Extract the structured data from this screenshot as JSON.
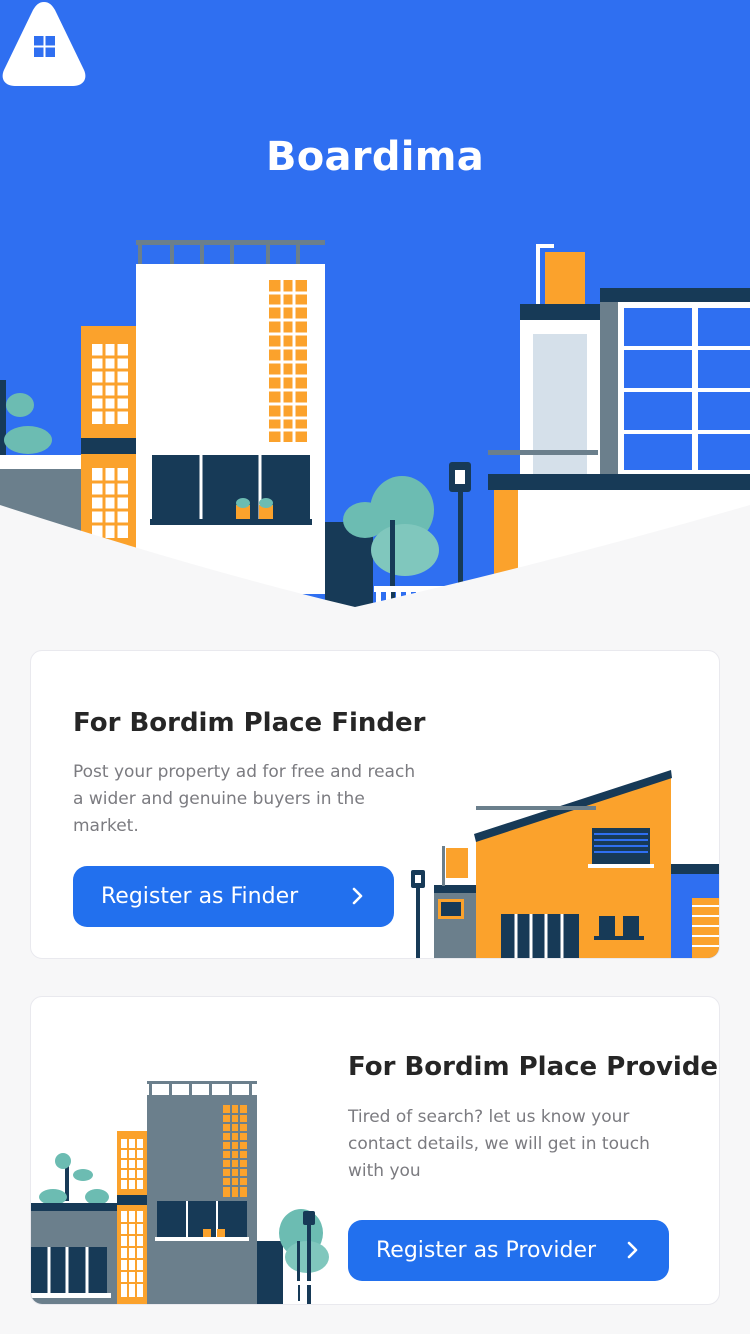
{
  "app": {
    "brand": "Boardima"
  },
  "colors": {
    "primary": "#2270ee",
    "hero_bg": "#2f6ff1",
    "navy": "#173a57",
    "orange": "#fba22c",
    "teal": "#6cbcb2",
    "page_bg": "#f7f7f8"
  },
  "icons": {
    "logo": "house-window-logo",
    "button_chevron": "chevron-right-icon"
  },
  "finder": {
    "title": "For Bordim Place Finder",
    "description": "Post your property ad for free and reach a wider and genuine buyers in the market.",
    "button_label": "Register as Finder"
  },
  "provider": {
    "title": "For Bordim Place Provider",
    "description": "Tired of search? let us know your contact details, we will get in touch with you",
    "button_label": "Register as Provider"
  }
}
